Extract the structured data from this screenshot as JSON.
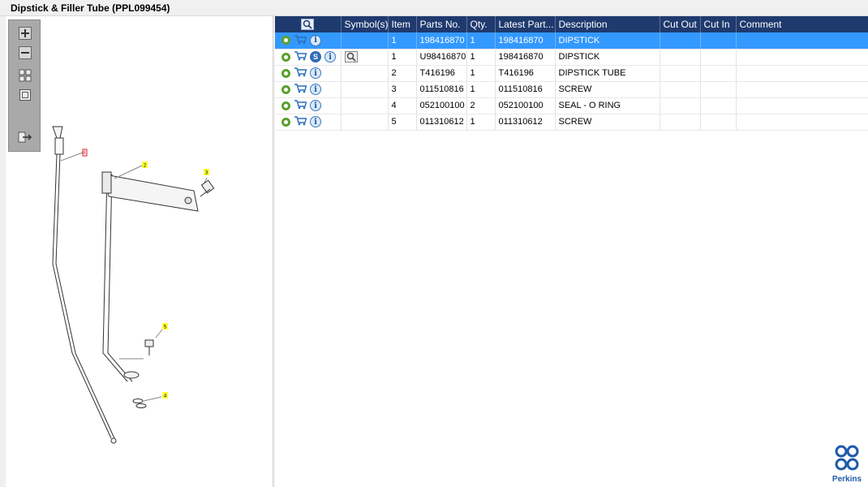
{
  "window": {
    "title": "Dipstick & Filler Tube (PPL099454)"
  },
  "toolbar": {
    "zoom_in": "zoom-in",
    "zoom_out": "zoom-out",
    "fit": "fit",
    "reset": "reset",
    "export": "export"
  },
  "drawing": {
    "callouts": [
      "8",
      "2",
      "3",
      "5",
      "4"
    ]
  },
  "table": {
    "columns": [
      "",
      "Symbol(s)",
      "Item",
      "Parts No.",
      "Qty.",
      "Latest Part...",
      "Description",
      "Cut Out",
      "Cut In",
      "Comment"
    ],
    "rows": [
      {
        "item": "1",
        "parts_no": "198416870",
        "qty": "1",
        "latest": "198416870",
        "description": "DIPSTICK",
        "cut_out": "",
        "cut_in": "",
        "comment": "",
        "selected": true,
        "has_s": false,
        "has_symbol": false
      },
      {
        "item": "1",
        "parts_no": "U98416870",
        "qty": "1",
        "latest": "198416870",
        "description": "DIPSTICK",
        "cut_out": "",
        "cut_in": "",
        "comment": "",
        "selected": false,
        "has_s": true,
        "has_symbol": true
      },
      {
        "item": "2",
        "parts_no": "T416196",
        "qty": "1",
        "latest": "T416196",
        "description": "DIPSTICK TUBE",
        "cut_out": "",
        "cut_in": "",
        "comment": "",
        "selected": false,
        "has_s": false,
        "has_symbol": false
      },
      {
        "item": "3",
        "parts_no": "011510816",
        "qty": "1",
        "latest": "011510816",
        "description": "SCREW",
        "cut_out": "",
        "cut_in": "",
        "comment": "",
        "selected": false,
        "has_s": false,
        "has_symbol": false
      },
      {
        "item": "4",
        "parts_no": "052100100",
        "qty": "2",
        "latest": "052100100",
        "description": "SEAL - O RING",
        "cut_out": "",
        "cut_in": "",
        "comment": "",
        "selected": false,
        "has_s": false,
        "has_symbol": false
      },
      {
        "item": "5",
        "parts_no": "011310612",
        "qty": "1",
        "latest": "011310612",
        "description": "SCREW",
        "cut_out": "",
        "cut_in": "",
        "comment": "",
        "selected": false,
        "has_s": false,
        "has_symbol": false
      }
    ]
  },
  "brand": {
    "name": "Perkins",
    "color": "#1e5aa8"
  },
  "colors": {
    "header": "#1f3a6e",
    "selected_row": "#3399ff",
    "gear": "#5aa02c"
  }
}
